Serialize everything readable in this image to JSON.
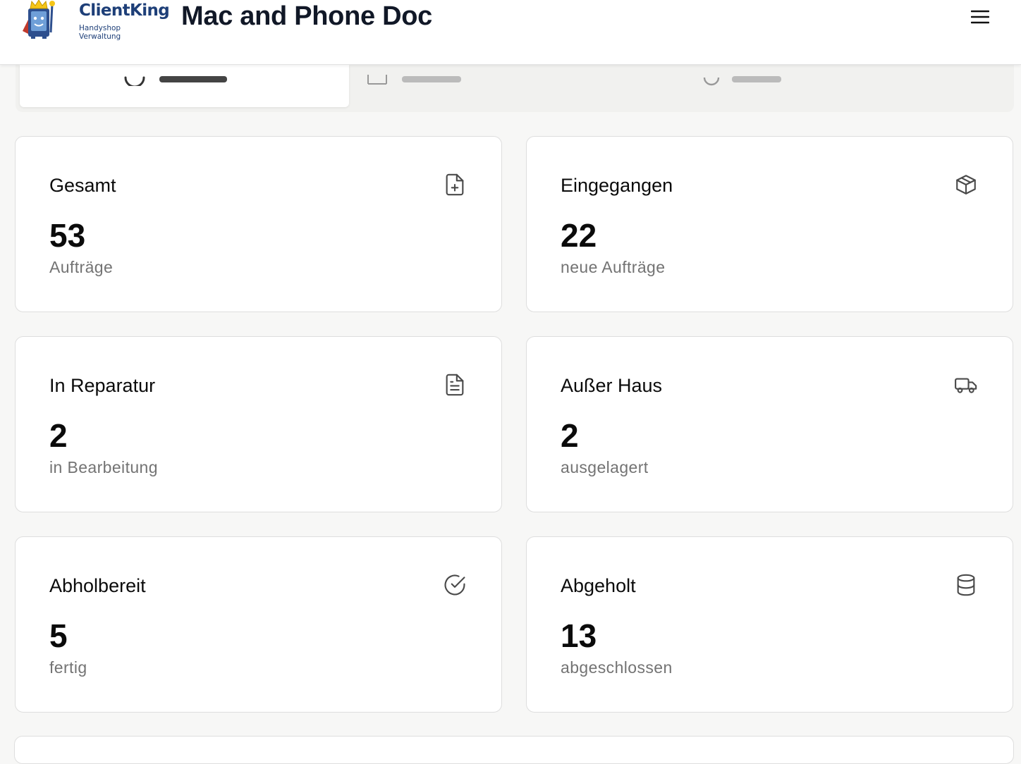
{
  "header": {
    "logo_name": "ClientKing",
    "logo_tagline": "Handyshop Verwaltung",
    "title": "Mac and Phone Doc",
    "menu_icon": "hamburger-menu-icon"
  },
  "stats": [
    {
      "title": "Gesamt",
      "value": "53",
      "subtitle": "Aufträge",
      "icon": "file-plus-icon"
    },
    {
      "title": "Eingegangen",
      "value": "22",
      "subtitle": "neue Aufträge",
      "icon": "package-icon"
    },
    {
      "title": "In Reparatur",
      "value": "2",
      "subtitle": "in Bearbeitung",
      "icon": "file-text-icon"
    },
    {
      "title": "Außer Haus",
      "value": "2",
      "subtitle": "ausgelagert",
      "icon": "truck-icon"
    },
    {
      "title": "Abholbereit",
      "value": "5",
      "subtitle": "fertig",
      "icon": "check-circle-icon"
    },
    {
      "title": "Abgeholt",
      "value": "13",
      "subtitle": "abgeschlossen",
      "icon": "database-icon"
    }
  ],
  "colors": {
    "brand": "#1e3f78",
    "text": "#0b0b0b",
    "muted": "#737373",
    "border": "#dedede",
    "background": "#f7f7f6"
  }
}
